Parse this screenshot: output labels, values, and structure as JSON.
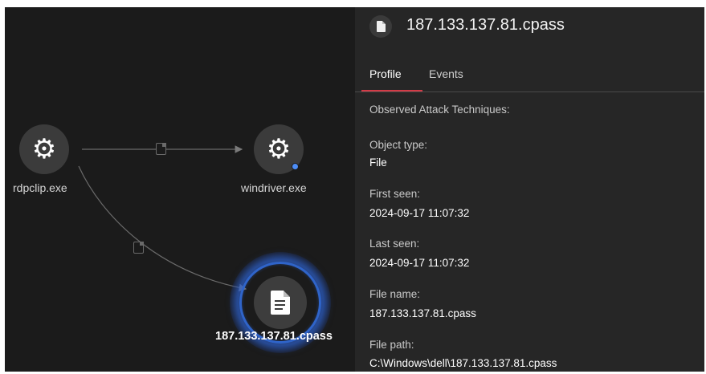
{
  "graph": {
    "nodes": [
      {
        "label": "rdpclip.exe",
        "icon": "gear-icon"
      },
      {
        "label": "windriver.exe",
        "icon": "gear-icon",
        "status_color": "#4d8df6"
      },
      {
        "label": "187.133.137.81.cpass",
        "icon": "file-icon",
        "selected": true
      }
    ],
    "edge_icons": [
      "file-icon",
      "file-icon"
    ]
  },
  "panel": {
    "title": "187.133.137.81.cpass",
    "title_icon": "file-icon",
    "tabs": [
      {
        "label": "Profile",
        "active": true
      },
      {
        "label": "Events",
        "active": false
      }
    ],
    "attack_techniques_label": "Observed Attack Techniques:",
    "fields": [
      {
        "label": "Object type:",
        "value": "File"
      },
      {
        "label": "First seen:",
        "value": "2024-09-17 11:07:32"
      },
      {
        "label": "Last seen:",
        "value": "2024-09-17 11:07:32"
      },
      {
        "label": "File name:",
        "value": "187.133.137.81.cpass"
      },
      {
        "label": "File path:",
        "value": "C:\\Windows\\dell\\187.133.137.81.cpass"
      }
    ]
  },
  "colors": {
    "background": "#1b1b1b",
    "panel": "#262626",
    "accent_tab": "#d33b47",
    "selection_glow": "#2f64c9",
    "status_dot": "#4d8df6"
  }
}
